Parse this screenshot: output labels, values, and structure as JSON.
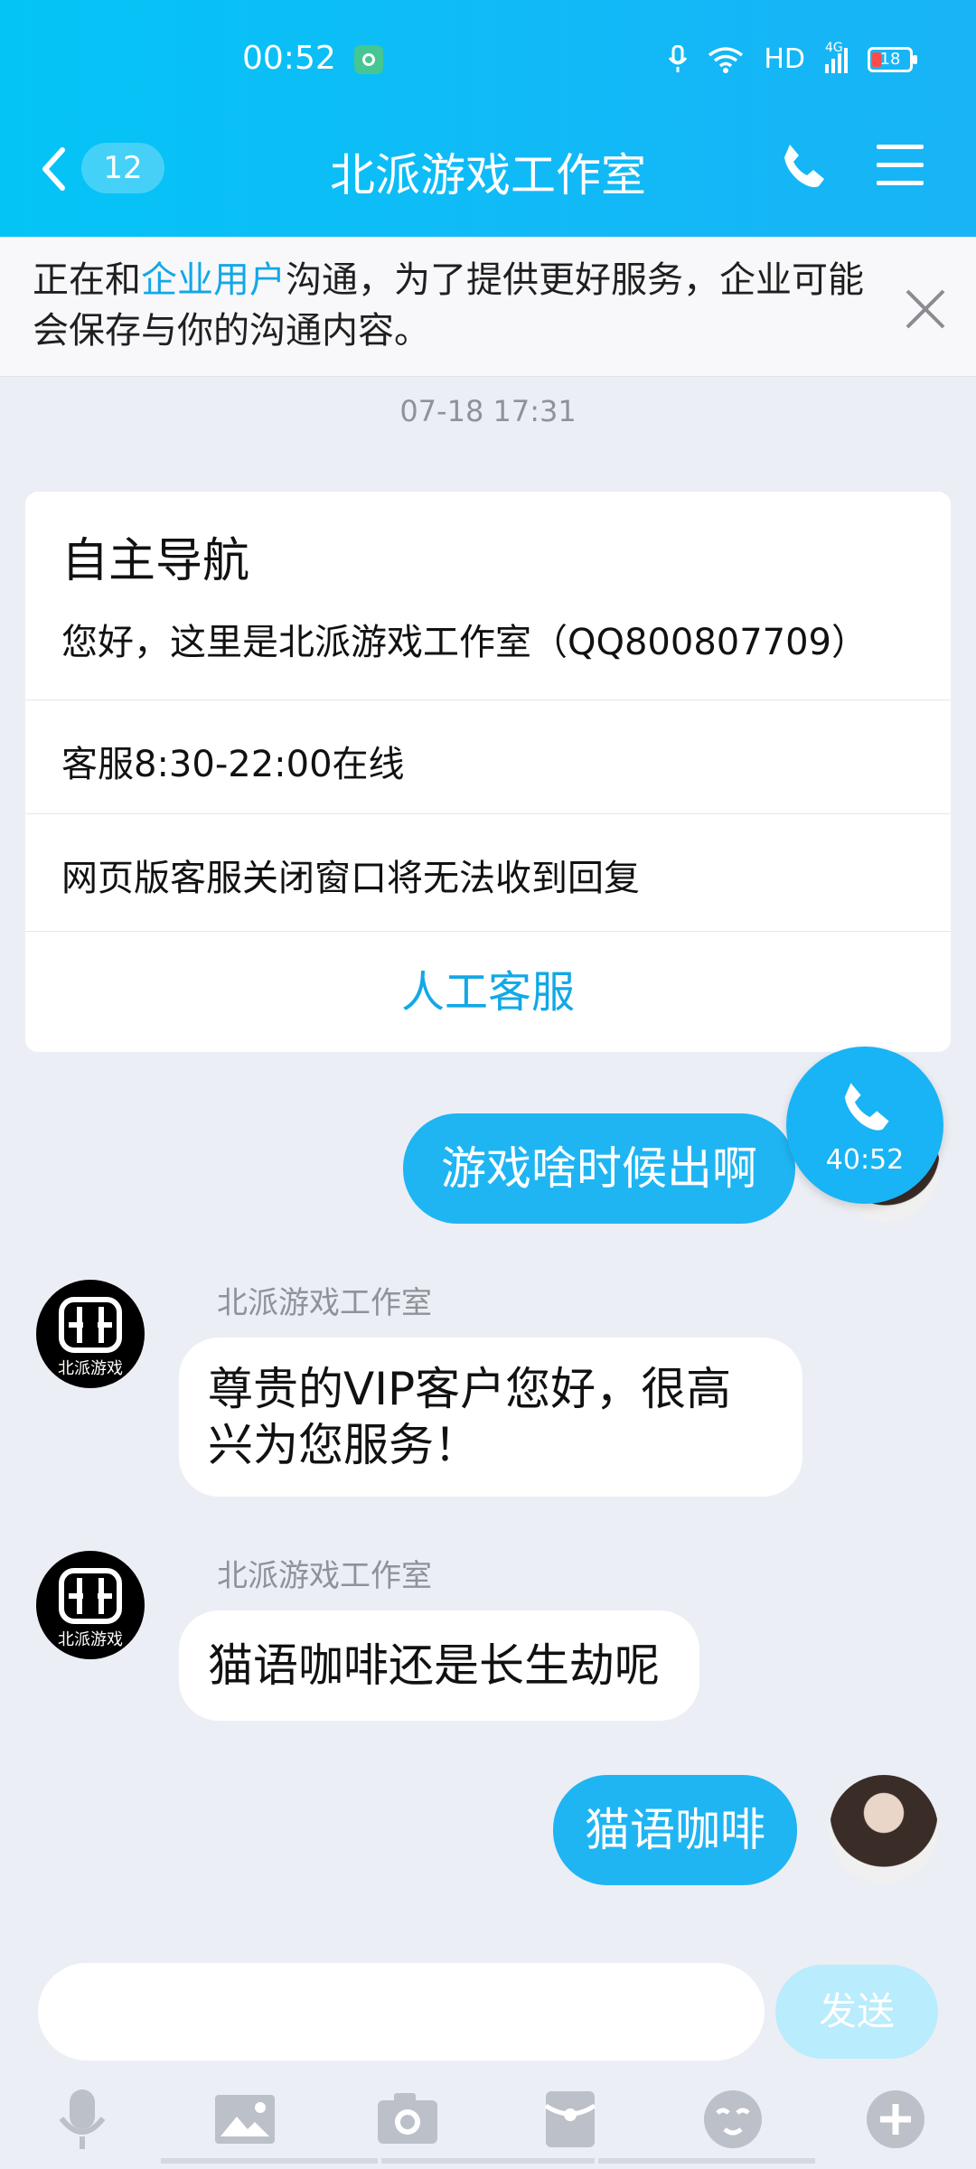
{
  "status_bar": {
    "time": "00:52",
    "network": "HD",
    "signal_type": "4G",
    "battery": "18"
  },
  "nav": {
    "unread_count": "12",
    "title": "北派游戏工作室"
  },
  "notice": {
    "text_before": "正在和",
    "highlight": "企业用户",
    "text_after": "沟通，为了提供更好服务，企业可能会保存与你的沟通内容。"
  },
  "timestamp": "07-18 17:31",
  "card": {
    "title": "自主导航",
    "greeting": "您好，这里是北派游戏工作室（QQ800807709）",
    "rows": [
      "客服8:30-22:00在线",
      "网页版客服关闭窗口将无法收到回复"
    ],
    "action": "人工客服"
  },
  "messages": [
    {
      "side": "out",
      "text": "游戏啥时候出啊"
    },
    {
      "side": "in",
      "sender": "北派游戏工作室",
      "text": "尊贵的VIP客户您好，很高兴为您服务！"
    },
    {
      "side": "in",
      "sender": "北派游戏工作室",
      "text": "猫语咖啡还是长生劫呢"
    },
    {
      "side": "out",
      "text": "猫语咖啡"
    }
  ],
  "call_float": {
    "duration": "40:52"
  },
  "avatar_brand_text": "北派游戏",
  "input": {
    "send_label": "发送"
  },
  "toolbar_icons": [
    "microphone-icon",
    "image-icon",
    "camera-icon",
    "red-packet-icon",
    "emoji-icon",
    "plus-icon"
  ],
  "colors": {
    "accent": "#12a8e6",
    "bubble_out": "#1fb5f3",
    "header": "#04c4f6"
  }
}
